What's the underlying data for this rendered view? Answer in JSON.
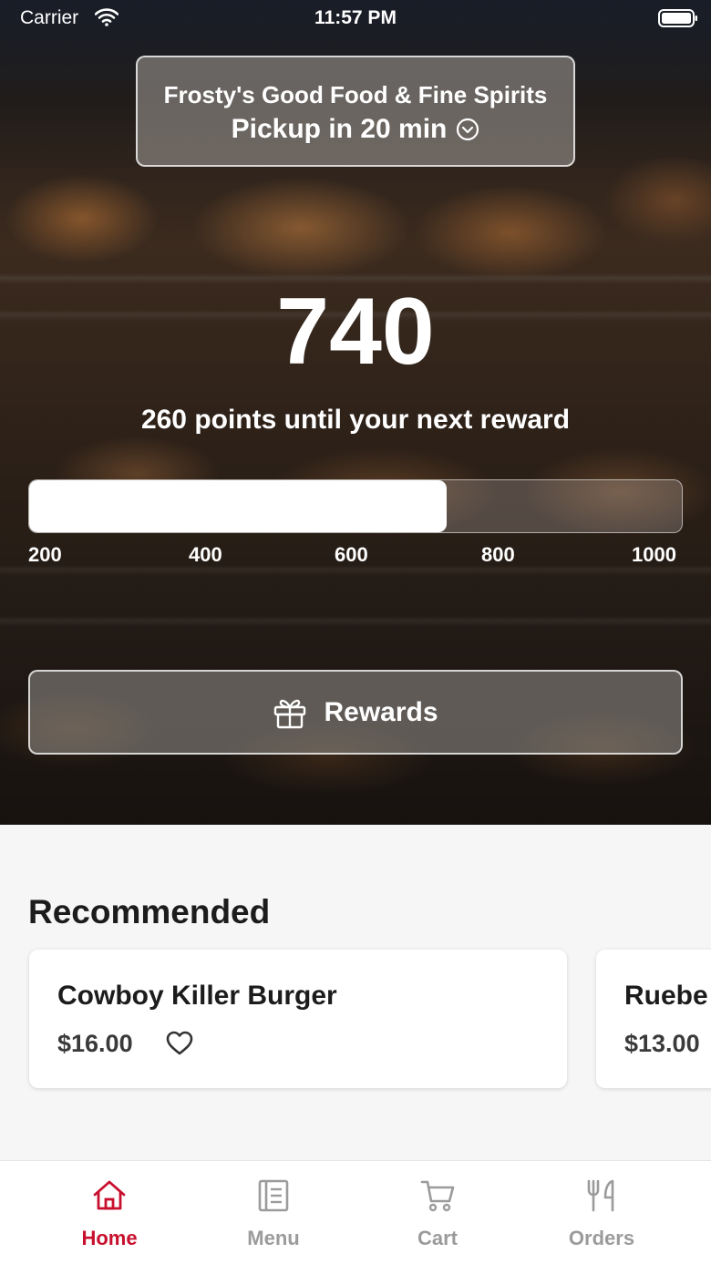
{
  "status_bar": {
    "carrier": "Carrier",
    "time": "11:57 PM"
  },
  "location": {
    "name": "Frosty's Good Food & Fine Spirits",
    "pickup": "Pickup in 20 min"
  },
  "rewards": {
    "points": "740",
    "caption": "260 points until your next reward",
    "progress": 0.64,
    "ticks": [
      "200",
      "400",
      "600",
      "800",
      "1000"
    ],
    "button_label": "Rewards"
  },
  "recommended": {
    "title": "Recommended",
    "items": [
      {
        "name": "Cowboy Killer Burger",
        "price": "$16.00"
      },
      {
        "name": "Ruebe",
        "price": "$13.00"
      }
    ]
  },
  "tabs": [
    {
      "label": "Home",
      "icon": "home-icon",
      "active": true
    },
    {
      "label": "Menu",
      "icon": "menu-icon",
      "active": false
    },
    {
      "label": "Cart",
      "icon": "cart-icon",
      "active": false
    },
    {
      "label": "Orders",
      "icon": "orders-icon",
      "active": false
    }
  ],
  "colors": {
    "accent": "#c8102e",
    "inactive": "#9b9b9b"
  }
}
